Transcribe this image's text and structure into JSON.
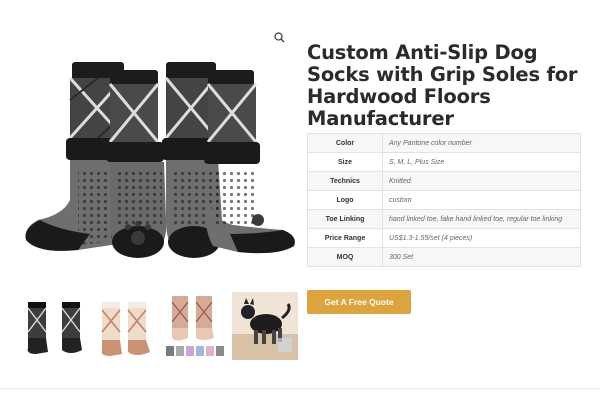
{
  "product": {
    "title": "Custom Anti-Slip Dog Socks with Grip Soles for Hardwood Floors Manufacturer"
  },
  "specs": [
    {
      "label": "Color",
      "value": "Any Pantone color number"
    },
    {
      "label": "Size",
      "value": "S, M, L, Plus Size"
    },
    {
      "label": "Technics",
      "value": "Knitted"
    },
    {
      "label": "Logo",
      "value": "custom"
    },
    {
      "label": "Toe Linking",
      "value": "hand linked toe, fake hand linked toe, regular toe linking"
    },
    {
      "label": "Price Range",
      "value": "US$1.3-1.55/set (4 pieces)"
    },
    {
      "label": "MOQ",
      "value": "300 Set"
    }
  ],
  "cta": {
    "quote_label": "Get A Free Quote"
  },
  "icons": {
    "zoom": "magnifier-icon"
  },
  "thumbnails": [
    {
      "alt": "black grey argyle dog socks"
    },
    {
      "alt": "beige pink argyle dog socks"
    },
    {
      "alt": "pink socks color variants"
    },
    {
      "alt": "dog wearing socks on floor"
    }
  ],
  "colors": {
    "accent": "#dda33c",
    "title": "#2b2b2b"
  }
}
